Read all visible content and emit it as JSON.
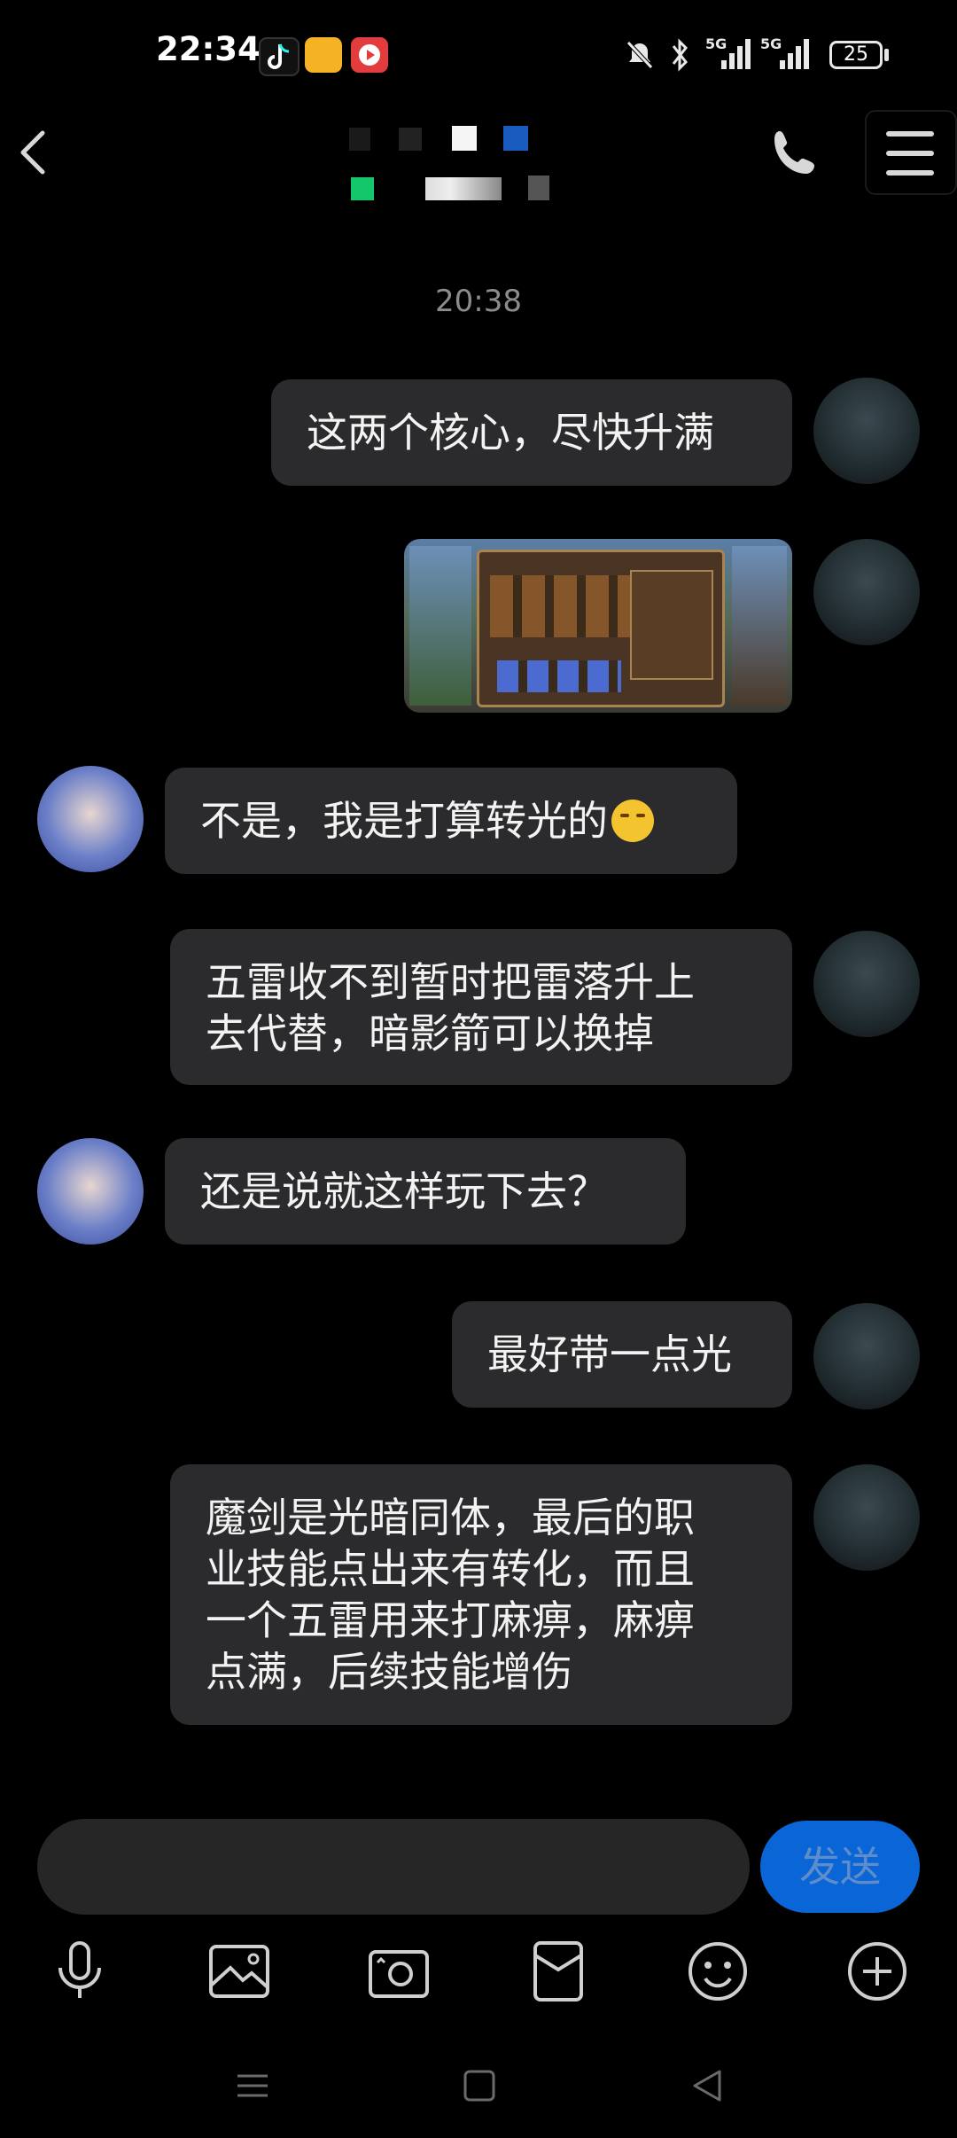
{
  "status_bar": {
    "time": "22:34",
    "network_1": "5G",
    "network_2": "5G",
    "battery": "25"
  },
  "header": {
    "back_icon": "chevron-left-icon",
    "call_icon": "phone-icon",
    "menu_icon": "hamburger-menu-icon"
  },
  "chat": {
    "timestamp": "20:38",
    "messages": [
      {
        "sender": "self",
        "type": "text",
        "text": "这两个核心，尽快升满"
      },
      {
        "sender": "self",
        "type": "image",
        "text": ""
      },
      {
        "sender": "other",
        "type": "text",
        "text": "不是，我是打算转光的"
      },
      {
        "sender": "self",
        "type": "text",
        "text": "五雷收不到暂时把雷落升上\n去代替，暗影箭可以换掉"
      },
      {
        "sender": "other",
        "type": "text",
        "text": "还是说就这样玩下去？"
      },
      {
        "sender": "self",
        "type": "text",
        "text": "最好带一点光"
      },
      {
        "sender": "self",
        "type": "text",
        "text": "魔剑是光暗同体，最后的职\n业技能点出来有转化，而且\n一个五雷用来打麻痹，麻痹\n点满，后续技能增伤"
      }
    ]
  },
  "composer": {
    "input_value": "",
    "send_label": "发送"
  },
  "toolbar": {
    "icons": [
      "microphone-icon",
      "image-icon",
      "camera-icon",
      "red-packet-icon",
      "emoji-icon",
      "plus-icon"
    ]
  },
  "nav": {
    "icons": [
      "recent-apps-icon",
      "home-icon",
      "back-triangle-icon"
    ]
  },
  "colors": {
    "background": "#000000",
    "bubble": "#2b2b2d",
    "send_button": "#0a66d6",
    "text": "#f3f3f3",
    "timestamp": "#8c8c8c"
  }
}
